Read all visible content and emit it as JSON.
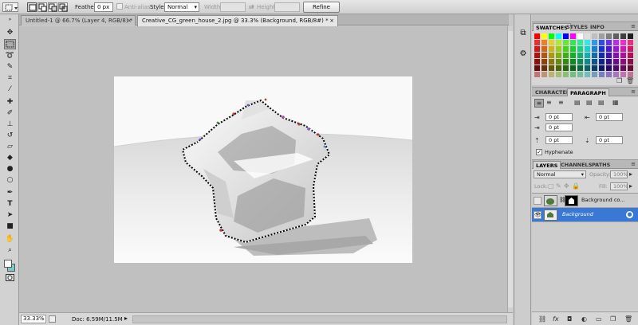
{
  "options_bar": {
    "feather_label": "Feather:",
    "feather_value": "0 px",
    "anti_alias_label": "Anti-alias",
    "style_label": "Style:",
    "style_value": "Normal",
    "width_label": "Width:",
    "height_label": "Height:",
    "refine_edge_label": "Refine Edge..."
  },
  "tabs": [
    {
      "label": "Untitled-1 @ 66.7% (Layer 4, RGB/8) *",
      "close": "×"
    },
    {
      "label": "Creative_CG_green_house_2.jpg @ 33.3% (Background, RGB/8#) *",
      "close": "×"
    }
  ],
  "status": {
    "zoom": "33.33%",
    "doc": "Doc: 6.59M/11.5M",
    "arrow": "▸"
  },
  "toolbox": {
    "foreground_color": "#ffffff",
    "background_color": "#7ec9c6"
  },
  "swatches_panel": {
    "tabs": [
      "SWATCHES",
      "STYLES",
      "INFO"
    ]
  },
  "character_panel": {
    "tabs": [
      "CHARACTER",
      "PARAGRAPH"
    ],
    "indent_left": "0 pt",
    "indent_right": "0 pt",
    "first_line": "0 pt",
    "space_before": "0 pt",
    "space_after": "0 pt",
    "hyphenate_label": "Hyphenate"
  },
  "layers_panel": {
    "tabs": [
      "LAYERS",
      "CHANNELS",
      "PATHS"
    ],
    "blend_mode": "Normal",
    "opacity_label": "Opacity:",
    "opacity_value": "100%",
    "lock_label": "Lock:",
    "fill_label": "Fill:",
    "fill_value": "100%",
    "layers": [
      {
        "name": "Background co...",
        "selected": false
      },
      {
        "name": "Background",
        "selected": true
      }
    ],
    "footer_icons": [
      "link-icon",
      "fx-icon",
      "mask-icon",
      "adjustment-icon",
      "folder-icon",
      "new-layer-icon",
      "trash-icon"
    ]
  }
}
